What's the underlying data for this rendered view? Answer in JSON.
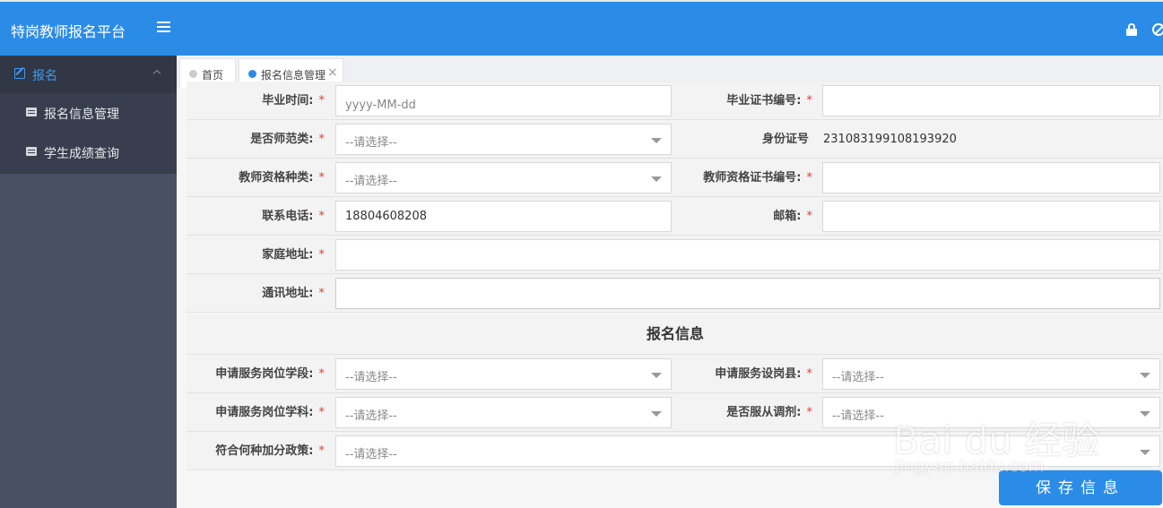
{
  "header": {
    "title": "特岗教师报名平台"
  },
  "sidebar": {
    "group_label": "报名",
    "items": [
      {
        "label": "报名信息管理"
      },
      {
        "label": "学生成绩查询"
      }
    ]
  },
  "tabs": [
    {
      "label": "首页",
      "dot_color": "#cccccc"
    },
    {
      "label": "报名信息管理",
      "dot_color": "#2b8ce8"
    }
  ],
  "form": {
    "rows": [
      {
        "left_label": "毕业时间:",
        "left_placeholder": "yyyy-MM-dd",
        "right_label": "毕业证书编号:",
        "right_value": ""
      },
      {
        "left_label": "是否师范类:",
        "left_placeholder": "--请选择--",
        "right_label": "身份证号",
        "right_value": "231083199108193920"
      },
      {
        "left_label": "教师资格种类:",
        "left_placeholder": "--请选择--",
        "right_label": "教师资格证书编号:",
        "right_value": ""
      },
      {
        "left_label": "联系电话:",
        "left_value": "18804608208",
        "right_label": "邮箱:",
        "right_value": ""
      },
      {
        "left_label": "家庭地址:",
        "left_value": ""
      },
      {
        "left_label": "通讯地址:",
        "left_value": ""
      }
    ],
    "section_title": "报名信息",
    "apply_rows": [
      {
        "left_label": "申请服务岗位学段:",
        "left_placeholder": "--请选择--",
        "right_label": "申请服务设岗县:",
        "right_placeholder": "--请选择--"
      },
      {
        "left_label": "申请服务岗位学科:",
        "left_placeholder": "--请选择--",
        "right_label": "是否服从调剂:",
        "right_placeholder": "--请选择--"
      },
      {
        "left_label": "符合何种加分政策:",
        "left_placeholder": "--请选择--"
      }
    ],
    "required_mark": "*",
    "save_label": "保存信息"
  },
  "watermark": {
    "main": "Bai du 经验",
    "sub": "jingyan.baidu.com"
  }
}
